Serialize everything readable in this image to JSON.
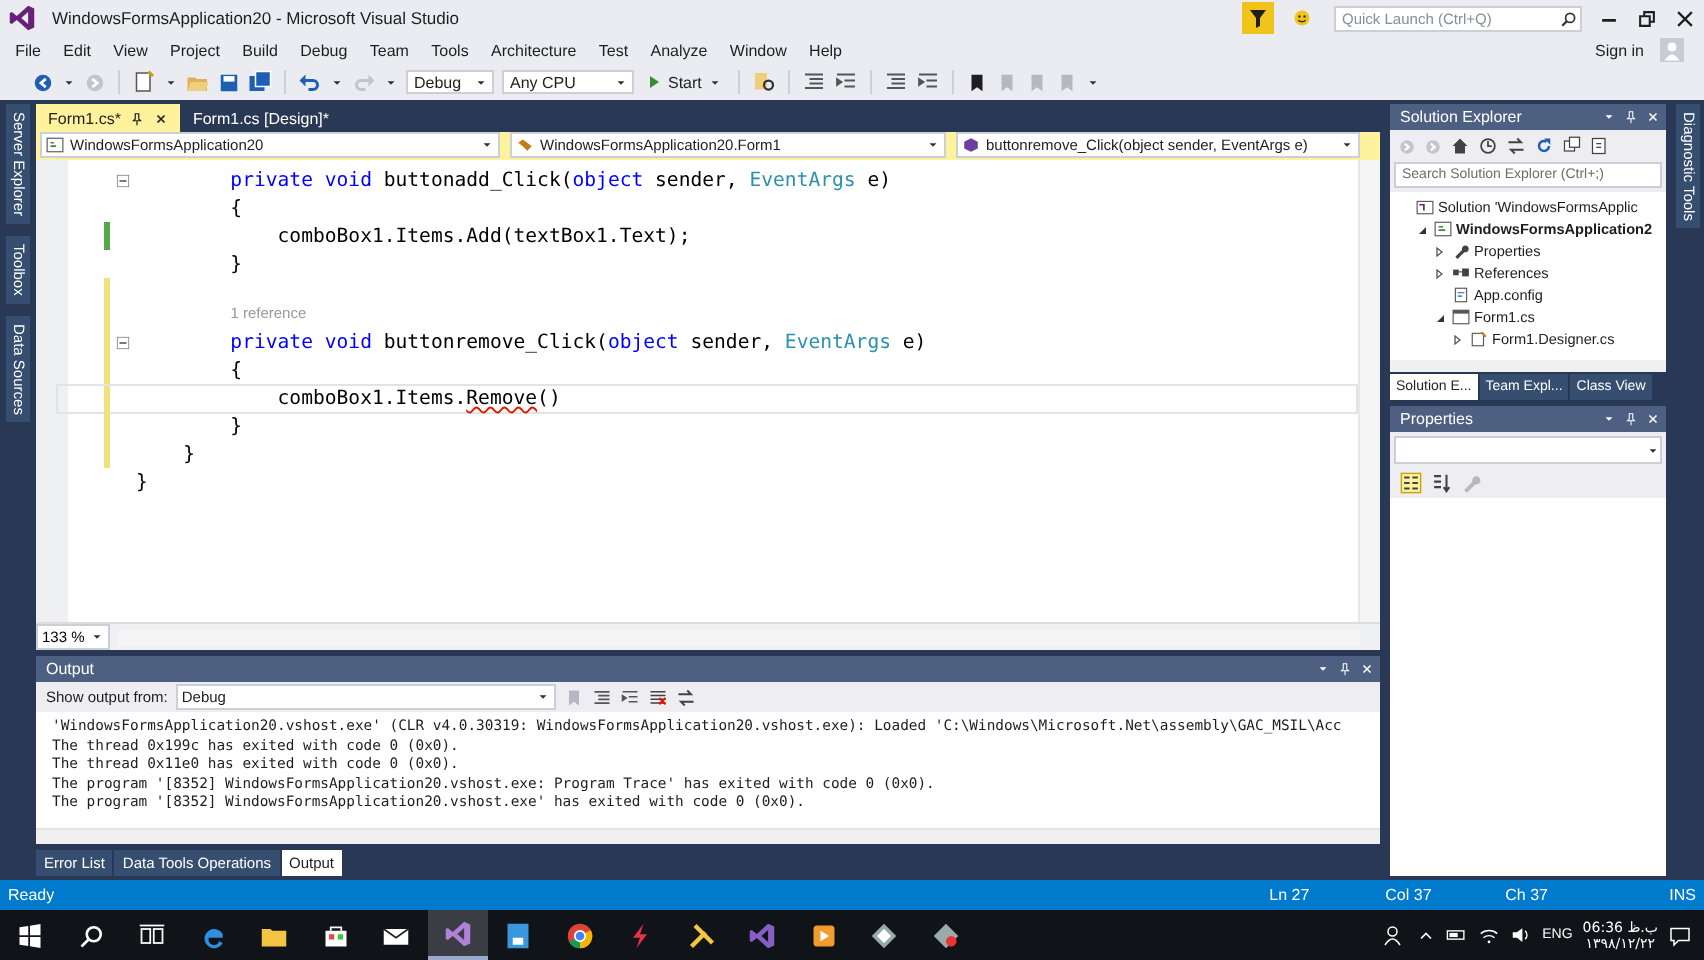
{
  "window": {
    "title": "WindowsFormsApplication20 - Microsoft Visual Studio"
  },
  "quick_launch": {
    "placeholder": "Quick Launch (Ctrl+Q)"
  },
  "menu": [
    "File",
    "Edit",
    "View",
    "Project",
    "Build",
    "Debug",
    "Team",
    "Tools",
    "Architecture",
    "Test",
    "Analyze",
    "Window",
    "Help"
  ],
  "account": {
    "label": "Sign in"
  },
  "toolbar": {
    "configuration": "Debug",
    "platform": "Any CPU",
    "start": "Start"
  },
  "left_tool_tabs": [
    "Server Explorer",
    "Toolbox",
    "Data Sources"
  ],
  "right_tool_tabs": [
    "Diagnostic Tools"
  ],
  "editor": {
    "tabs": [
      {
        "label": "Form1.cs*",
        "selected": true
      },
      {
        "label": "Form1.cs [Design]*",
        "selected": false
      }
    ],
    "navigation": [
      {
        "kind": "project",
        "label": "WindowsFormsApplication20"
      },
      {
        "kind": "class",
        "label": "WindowsFormsApplication20.Form1"
      },
      {
        "kind": "method",
        "label": "buttonremove_Click(object sender, EventArgs e)"
      }
    ],
    "lines": [
      {
        "kind": "code",
        "fold": true,
        "current": false,
        "tokens": [
          {
            "kind": "keyword",
            "text": "        private void"
          },
          {
            "kind": "plain",
            "text": " buttonadd_Click("
          },
          {
            "kind": "keyword",
            "text": "object"
          },
          {
            "kind": "plain",
            "text": " sender, "
          },
          {
            "kind": "type",
            "text": "EventArgs"
          },
          {
            "kind": "plain",
            "text": " e)"
          }
        ]
      },
      {
        "kind": "code",
        "current": false,
        "tokens": [
          {
            "kind": "plain",
            "text": "        {"
          }
        ]
      },
      {
        "kind": "code",
        "color": "#57a64a",
        "current": false,
        "tokens": [
          {
            "kind": "plain",
            "text": "            comboBox1.Items.Add(textBox1.Text);"
          }
        ]
      },
      {
        "kind": "code",
        "current": false,
        "tokens": [
          {
            "kind": "plain",
            "text": "        }"
          }
        ]
      },
      {
        "kind": "code",
        "color": "#efe27a",
        "current": false
      },
      {
        "kind": "codelens",
        "color": "#efe27a",
        "text": "1 reference"
      },
      {
        "kind": "code",
        "fold": true,
        "color": "#efe27a",
        "current": false,
        "tokens": [
          {
            "kind": "keyword",
            "text": "        private void"
          },
          {
            "kind": "plain",
            "text": " buttonremove_Click("
          },
          {
            "kind": "keyword",
            "text": "object"
          },
          {
            "kind": "plain",
            "text": " sender, "
          },
          {
            "kind": "type",
            "text": "EventArgs"
          },
          {
            "kind": "plain",
            "text": " e)"
          }
        ]
      },
      {
        "kind": "code",
        "color": "#efe27a",
        "current": false,
        "tokens": [
          {
            "kind": "plain",
            "text": "        {"
          }
        ]
      },
      {
        "kind": "code",
        "color": "#efe27a",
        "current": true,
        "tokens": [
          {
            "kind": "plain",
            "text": "            comboBox1.Items."
          },
          {
            "kind": "error",
            "text": "Remove"
          },
          {
            "kind": "plain",
            "text": "()"
          }
        ]
      },
      {
        "kind": "code",
        "color": "#efe27a",
        "current": false,
        "tokens": [
          {
            "kind": "plain",
            "text": "        }"
          }
        ]
      },
      {
        "kind": "code",
        "color": "#efe27a",
        "current": false,
        "tokens": [
          {
            "kind": "plain",
            "text": "    }"
          }
        ]
      },
      {
        "kind": "code",
        "current": false,
        "tokens": [
          {
            "kind": "plain",
            "text": "}"
          }
        ]
      }
    ],
    "zoom": "133 %"
  },
  "output": {
    "title": "Output",
    "source_label": "Show output from:",
    "source": "Debug",
    "lines": [
      "'WindowsFormsApplication20.vshost.exe' (CLR v4.0.30319: WindowsFormsApplication20.vshost.exe): Loaded 'C:\\Windows\\Microsoft.Net\\assembly\\GAC_MSIL\\Acc",
      "The thread 0x199c has exited with code 0 (0x0).",
      "The thread 0x11e0 has exited with code 0 (0x0).",
      "The program '[8352] WindowsFormsApplication20.vshost.exe: Program Trace' has exited with code 0 (0x0).",
      "The program '[8352] WindowsFormsApplication20.vshost.exe' has exited with code 0 (0x0)."
    ],
    "tabs": [
      {
        "label": "Error List",
        "selected": false
      },
      {
        "label": "Data Tools Operations",
        "selected": false
      },
      {
        "label": "Output",
        "selected": true
      }
    ]
  },
  "solution_explorer": {
    "title": "Solution Explorer",
    "search": {
      "placeholder": "Search Solution Explorer (Ctrl+;)"
    },
    "tree": [
      {
        "kind": "solution",
        "label": "Solution 'WindowsFormsApplic",
        "children": [
          {
            "kind": "project",
            "label": "WindowsFormsApplication2",
            "expanded": true,
            "children": [
              {
                "kind": "properties",
                "label": "Properties",
                "expanded": false
              },
              {
                "kind": "references",
                "label": "References",
                "expanded": false
              },
              {
                "kind": "config",
                "label": "App.config"
              },
              {
                "kind": "form",
                "label": "Form1.cs",
                "expanded": true,
                "children": [
                  {
                    "kind": "designer",
                    "label": "Form1.Designer.cs",
                    "expanded": false
                  }
                ]
              }
            ]
          }
        ]
      }
    ],
    "tabs": [
      {
        "label": "Solution E...",
        "selected": true
      },
      {
        "label": "Team Expl...",
        "selected": false
      },
      {
        "label": "Class View",
        "selected": false
      }
    ]
  },
  "properties": {
    "title": "Properties"
  },
  "status_bar": {
    "state": "Ready",
    "line": "Ln 27",
    "column": "Col 37",
    "char": "Ch 37",
    "mode": "INS"
  },
  "taskbar": {
    "language": "ENG",
    "time": "06:36 ب.ظ",
    "date": "۱۳۹۸/۱۲/۲۲"
  }
}
